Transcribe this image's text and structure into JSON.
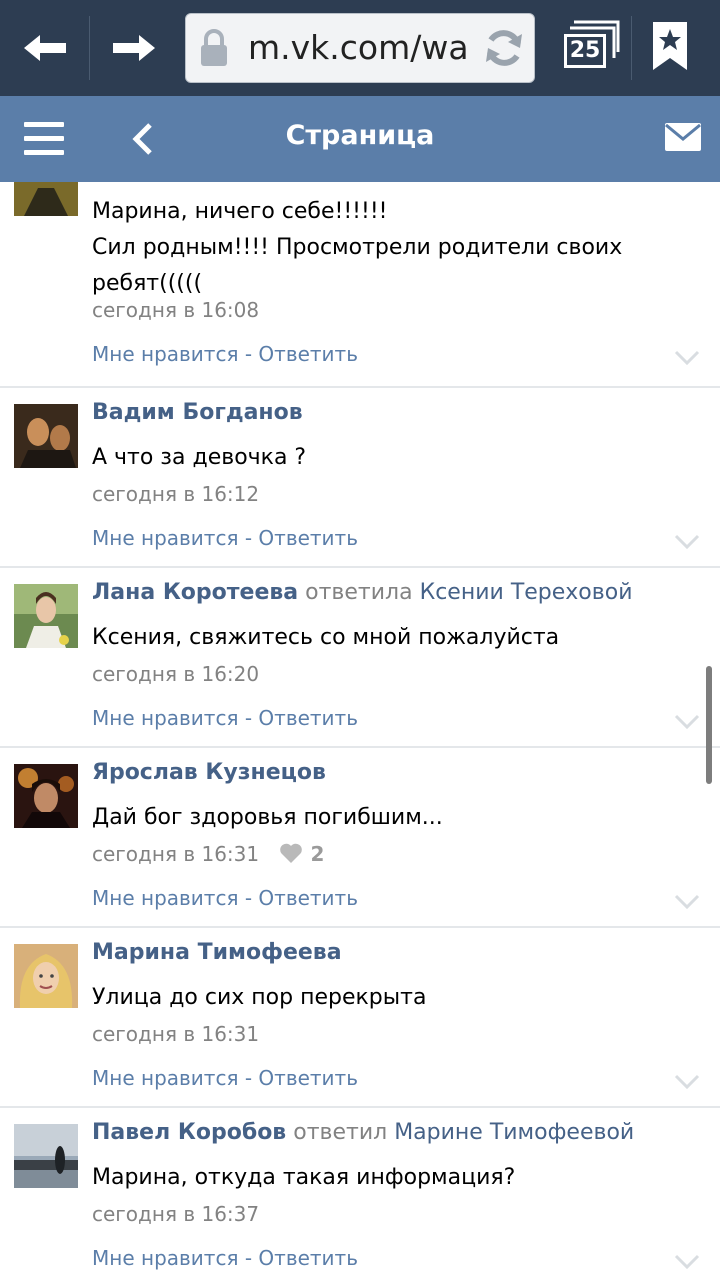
{
  "browser": {
    "url": "m.vk.com/wa",
    "tabs_count": "25"
  },
  "header": {
    "title": "Страница"
  },
  "comments": [
    {
      "author": "",
      "text": "Марина, ничего себе!!!!!!\nСил родным!!!! Просмотрели родители своих ребят(((((",
      "time": "сегодня в 16:08",
      "like_label": "Мне нравится",
      "separator": " - ",
      "reply_label": "Ответить"
    },
    {
      "author": "Вадим Богданов",
      "text": "А что за девочка ?",
      "time": "сегодня в 16:12",
      "like_label": "Мне нравится",
      "separator": " - ",
      "reply_label": "Ответить"
    },
    {
      "author": "Лана Коротеева",
      "reply_word": "ответила",
      "reply_target": "Ксении Тереховой",
      "text": "Ксения, свяжитесь со мной пожалуйста",
      "time": "сегодня в 16:20",
      "like_label": "Мне нравится",
      "separator": " - ",
      "reply_label": "Ответить"
    },
    {
      "author": "Ярослав Кузнецов",
      "text": "Дай бог здоровья погибшим...",
      "time": "сегодня в 16:31",
      "likes": "2",
      "like_label": "Мне нравится",
      "separator": " - ",
      "reply_label": "Ответить"
    },
    {
      "author": "Марина Тимофеева",
      "text": "Улица до сих пор перекрыта",
      "time": "сегодня в 16:31",
      "like_label": "Мне нравится",
      "separator": " - ",
      "reply_label": "Ответить"
    },
    {
      "author": "Павел Коробов",
      "reply_word": "ответил",
      "reply_target": "Марине Тимофеевой",
      "text": "Марина, откуда такая информация?",
      "time": "сегодня в 16:37",
      "like_label": "Мне нравится",
      "separator": " - ",
      "reply_label": "Ответить"
    }
  ],
  "colors": {
    "browser_bar": "#2d3d52",
    "vk_header": "#5b7ea9",
    "author_link": "#456187",
    "action_link": "#5b7ea9",
    "meta_text": "#828282"
  }
}
